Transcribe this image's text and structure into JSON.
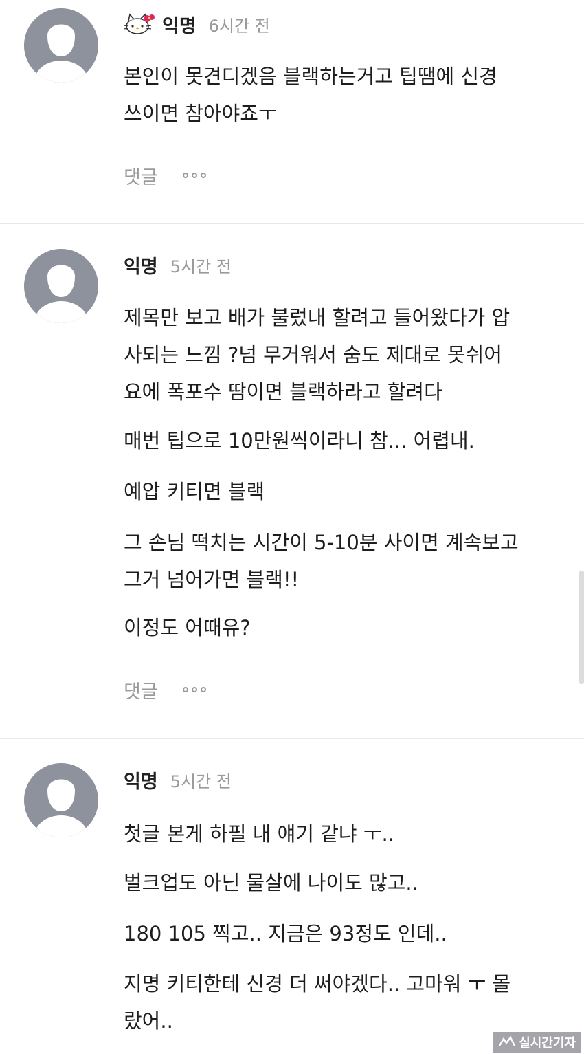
{
  "comments": [
    {
      "author": "익명",
      "time": "6시간 전",
      "has_badge_icon": true,
      "paragraphs": [
        "본인이 못견디겠음 블랙하는거고 팁땜에 신경",
        "쓰이면 참아야죠ㅜ"
      ],
      "reply_label": "댓글"
    },
    {
      "author": "익명",
      "time": "5시간 전",
      "has_badge_icon": false,
      "paragraphs": [
        "제목만 보고 배가 불렀내 할려고 들어왔다가 압",
        "사되는 느낌 ?넘 무거워서 숨도 제대로 못쉬어",
        "요에 폭포수 땀이면 블랙하라고 할려다",
        "매번 팁으로 10만원씩이라니 참... 어렵내.",
        "예압 키티면 블랙",
        "그 손님 떡치는 시간이 5-10분 사이면 계속보고",
        "그거 넘어가면 블랙!!",
        "이정도 어때유?"
      ],
      "reply_label": "댓글"
    },
    {
      "author": "익명",
      "time": "5시간 전",
      "has_badge_icon": false,
      "paragraphs": [
        "첫글 본게 하필 내 얘기 같냐 ㅜ..",
        "벌크업도 아닌 물살에 나이도 많고..",
        "180 105 찍고.. 지금은 93정도 인데..",
        "지명 키티한테 신경 더 써야겠다.. 고마워 ㅜ 몰",
        "랐어.."
      ]
    }
  ],
  "watermark": {
    "text": "실시간기자"
  },
  "icons": {
    "avatar": "default-avatar-icon",
    "badge": "hello-kitty-icon",
    "more": "more-dots-icon"
  },
  "colors": {
    "avatar_bg": "#8e929c",
    "muted_text": "#9a9a9a",
    "divider": "#e8e8e8"
  }
}
